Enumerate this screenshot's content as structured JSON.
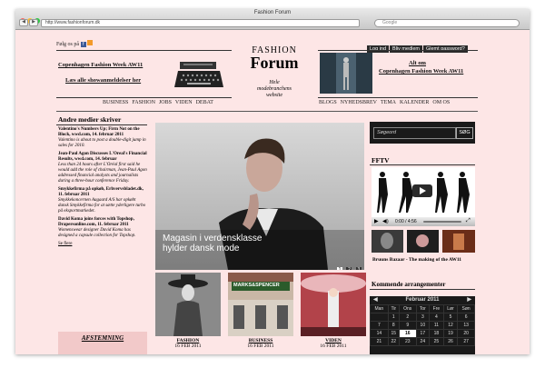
{
  "browser": {
    "title": "Fashion Forum",
    "url": "http://www.fashionforum.dk",
    "search_placeholder": "Google"
  },
  "header": {
    "follow": "Følg os på",
    "login": "Log ind",
    "member": "Bliv medlem",
    "forgot": "Glemt password?",
    "cfw_title": "Copenhagen Fashion Week AW11",
    "cfw_link": "Læs alle showanmeldelser her",
    "logo_fashion": "FASHION",
    "logo_forum": "Forum",
    "tagline1": "Hele",
    "tagline2": "modebranchens",
    "tagline3": "website",
    "ad_line1": "Alt om",
    "ad_line2": "Copenhagen Fashion Week AW11",
    "nav_left": [
      "BUSINESS",
      "FASHION",
      "JOBS",
      "VIDEN",
      "DEBAT"
    ],
    "nav_right": [
      "BLOGS",
      "NYHEDSBREV",
      "TEMA",
      "KALENDER",
      "OM OS"
    ]
  },
  "left": {
    "heading": "Andre medier skriver",
    "items": [
      {
        "h": "Valentino's Numbers Up; Firm Not on the Block, wwd.com, 14. februar 2011",
        "i": "Valentino is about to post a double-digit jump in sales for 2010."
      },
      {
        "h": "Jean-Paul Agon Discusses L'Oreal's Financial Results, wwd.com, 14. februar",
        "i": "Less than 24 hours after L'Oréal first said he would add the role of chairman, Jean-Paul Agon addressed financial analysts and journalists during a three-hour conference Friday."
      },
      {
        "h": "Smykkefirma på opkøb, Erhvervsbladet.dk, 11. februar 2011",
        "i": "Smykkekoncernen Aagaard A/S har opkøbt dansk Smykkefirma for at sætte yderligere turbo på eksportmarkedet."
      },
      {
        "h": "David Koma joins forces with Topshop, Drapersonline.com, 11. februar 2011",
        "i": "Womenswear designer David Koma has designed a capsule collection for Topshop."
      }
    ],
    "more": "Se flere",
    "poll": "AFSTEMNING"
  },
  "feature": {
    "headline1": "Magasin i verdensklasse",
    "headline2": "hylder dansk mode",
    "pages": [
      "1",
      "2",
      "3"
    ]
  },
  "thumbs": [
    {
      "cat": "FASHION",
      "date": "16 FEB 2011"
    },
    {
      "cat": "BUSINESS",
      "date": "16 FEB 2011",
      "sign": "MARKS&SPENCER"
    },
    {
      "cat": "VIDEN",
      "date": "16 FEB 2011"
    }
  ],
  "right": {
    "search_placeholder": "Søgeord",
    "search_btn": "SØG",
    "fftv": "FFTV",
    "time": "0:00 / 4:56",
    "video_caption": "Bruuns Bazaar - The making of the AW11",
    "events_heading": "Kommende arrangementer",
    "calendar": {
      "month": "Februar 2011",
      "days": [
        "Man",
        "Tir",
        "Ons",
        "Tor",
        "Fre",
        "Lør",
        "Søn"
      ],
      "rows": [
        [
          "",
          "1",
          "2",
          "3",
          "4",
          "5",
          "6"
        ],
        [
          "7",
          "8",
          "9",
          "10",
          "11",
          "12",
          "13"
        ],
        [
          "14",
          "15",
          "16",
          "17",
          "18",
          "19",
          "20"
        ],
        [
          "21",
          "22",
          "23",
          "24",
          "25",
          "26",
          "27"
        ]
      ],
      "highlight": "16"
    }
  },
  "colors": {
    "page_bg": "#fde6e6",
    "dark": "#1a1a1a"
  }
}
